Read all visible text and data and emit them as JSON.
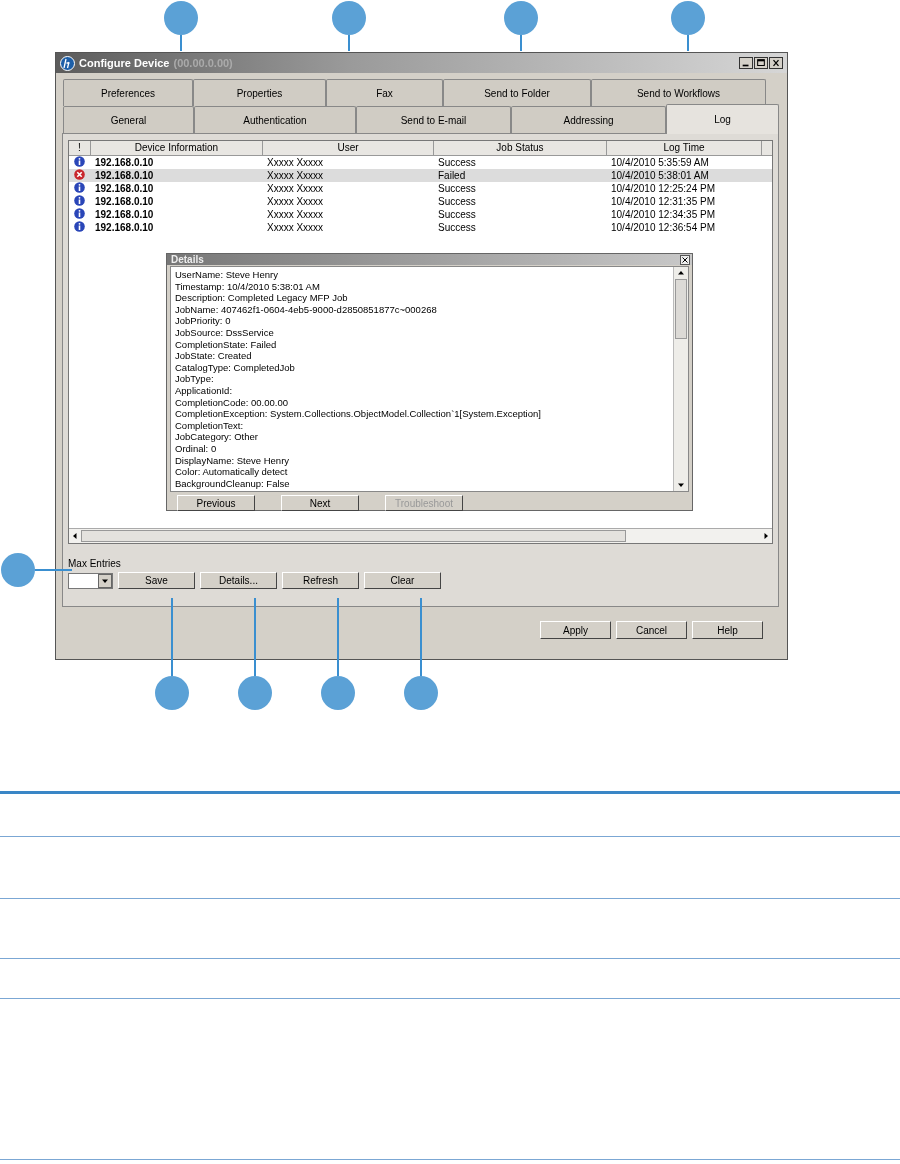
{
  "window": {
    "title": "Configure Device",
    "subtitle": "(00.00.0.00)"
  },
  "tab_rows": [
    [
      {
        "label": "Preferences",
        "selected": false
      },
      {
        "label": "Properties",
        "selected": false
      },
      {
        "label": "Fax",
        "selected": false
      },
      {
        "label": "Send to Folder",
        "selected": false
      },
      {
        "label": "Send to Workflows",
        "selected": false
      }
    ],
    [
      {
        "label": "General",
        "selected": false
      },
      {
        "label": "Authentication",
        "selected": false
      },
      {
        "label": "Send to E-mail",
        "selected": false
      },
      {
        "label": "Addressing",
        "selected": false
      },
      {
        "label": "Log",
        "selected": true
      }
    ]
  ],
  "table": {
    "columns": [
      "!",
      "Device Information",
      "User",
      "Job Status",
      "Log Time"
    ],
    "rows": [
      {
        "kind": "info",
        "selected": false,
        "cells": [
          "192.168.0.10",
          "Xxxxx Xxxxx",
          "Success",
          "10/4/2010 5:35:59 AM"
        ]
      },
      {
        "kind": "error",
        "selected": true,
        "cells": [
          "192.168.0.10",
          "Xxxxx Xxxxx",
          "Failed",
          "10/4/2010 5:38:01 AM"
        ]
      },
      {
        "kind": "info",
        "selected": false,
        "cells": [
          "192.168.0.10",
          "Xxxxx Xxxxx",
          "Success",
          "10/4/2010 12:25:24 PM"
        ]
      },
      {
        "kind": "info",
        "selected": false,
        "cells": [
          "192.168.0.10",
          "Xxxxx Xxxxx",
          "Success",
          "10/4/2010 12:31:35 PM"
        ]
      },
      {
        "kind": "info",
        "selected": false,
        "cells": [
          "192.168.0.10",
          "Xxxxx Xxxxx",
          "Success",
          "10/4/2010 12:34:35 PM"
        ]
      },
      {
        "kind": "info",
        "selected": false,
        "cells": [
          "192.168.0.10",
          "Xxxxx Xxxxx",
          "Success",
          "10/4/2010 12:36:54 PM"
        ]
      }
    ]
  },
  "details": {
    "title": "Details",
    "lines": [
      "UserName:  Steve Henry",
      "Timestamp:  10/4/2010 5:38:01 AM",
      "Description: Completed Legacy MFP Job",
      "JobName: 407462f1-0604-4eb5-9000-d2850851877c~000268",
      "JobPriority: 0",
      "JobSource: DssService",
      "CompletionState: Failed",
      "JobState: Created",
      "CatalogType: CompletedJob",
      "JobType:",
      "ApplicationId:",
      "CompletionCode: 00.00.00",
      "CompletionException: System.Collections.ObjectModel.Collection`1[System.Exception]",
      "CompletionText:",
      "JobCategory: Other",
      "Ordinal: 0",
      "DisplayName: Steve Henry",
      "Color: Automatically detect",
      "BackgroundCleanup: False"
    ],
    "buttons": [
      {
        "label": "Previous",
        "disabled": false
      },
      {
        "label": "Next",
        "disabled": false
      },
      {
        "label": "Troubleshoot",
        "disabled": true
      }
    ]
  },
  "max_entries": {
    "label": "Max Entries"
  },
  "log_buttons": [
    "Save",
    "Details...",
    "Refresh",
    "Clear"
  ],
  "dialog_buttons": [
    "Apply",
    "Cancel",
    "Help"
  ]
}
